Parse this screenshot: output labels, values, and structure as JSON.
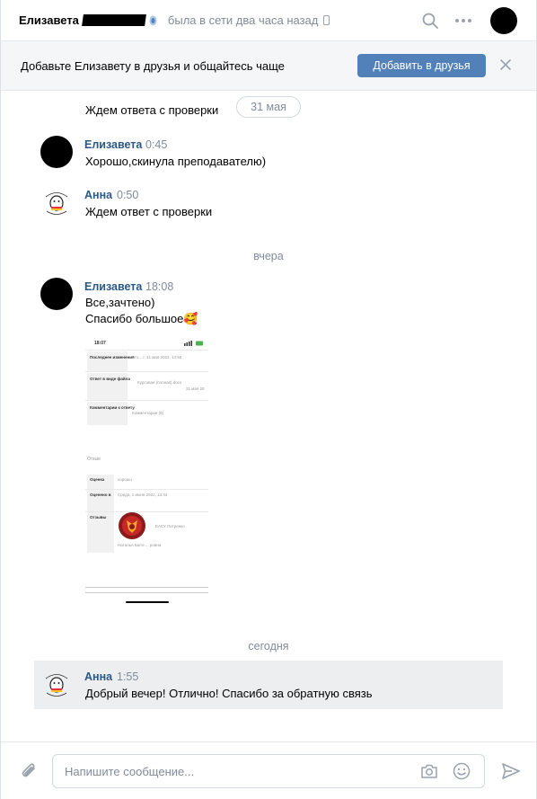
{
  "header": {
    "name": "Елизавета",
    "status": "была в сети два часа назад"
  },
  "banner": {
    "text": "Добавьте Елизавету в друзья и общайтесь чаще",
    "button": "Добавить в друзья"
  },
  "messages": [
    {
      "text": "Ждем ответа с проверки"
    },
    {
      "author": "Елизавета",
      "time": "0:45",
      "text": "Хорошо,скинула преподавателю)"
    },
    {
      "author": "Анна",
      "time": "0:50",
      "text": "Ждем ответ с проверки"
    },
    {
      "author": "Елизавета",
      "time": "18:08",
      "lines": [
        "Все,зачтено)",
        "Спасибо большое🥰"
      ]
    },
    {
      "author": "Анна",
      "time": "1:55",
      "text": "Добрый вечер! Отлично! Спасибо за обратную связь"
    }
  ],
  "dates": {
    "pill": "31 мая",
    "yesterday": "вчера",
    "today": "сегодня"
  },
  "attachment": {
    "clock": "18:07",
    "row1_label": "Последнее изменение",
    "row1_value": "Вто... г, 31 мая 2022, 13:58",
    "row2_label": "Ответ в виде файла",
    "row2_value": "Курсовая (полная).docx",
    "row2_date": "31 мая 20",
    "row3_label": "Комментарии к ответу",
    "row3_value": "Комментарии (0)",
    "section": "Отзыв",
    "grade_label": "Оценка",
    "grade_value": "хорошо",
    "graded_label": "Оценено в",
    "graded_value": "Среда, 1 июня 2022, 13:44",
    "review_label": "Отзывы",
    "sig_text": "ЕАСУ Петренко",
    "sig_name": "Наталья Бюте ... ровна"
  },
  "composer": {
    "placeholder": "Напишите сообщение..."
  },
  "colors": {
    "accent": "#5181b8",
    "author": "#2a5885",
    "muted": "#818c99",
    "highlight": "#edeef0"
  }
}
